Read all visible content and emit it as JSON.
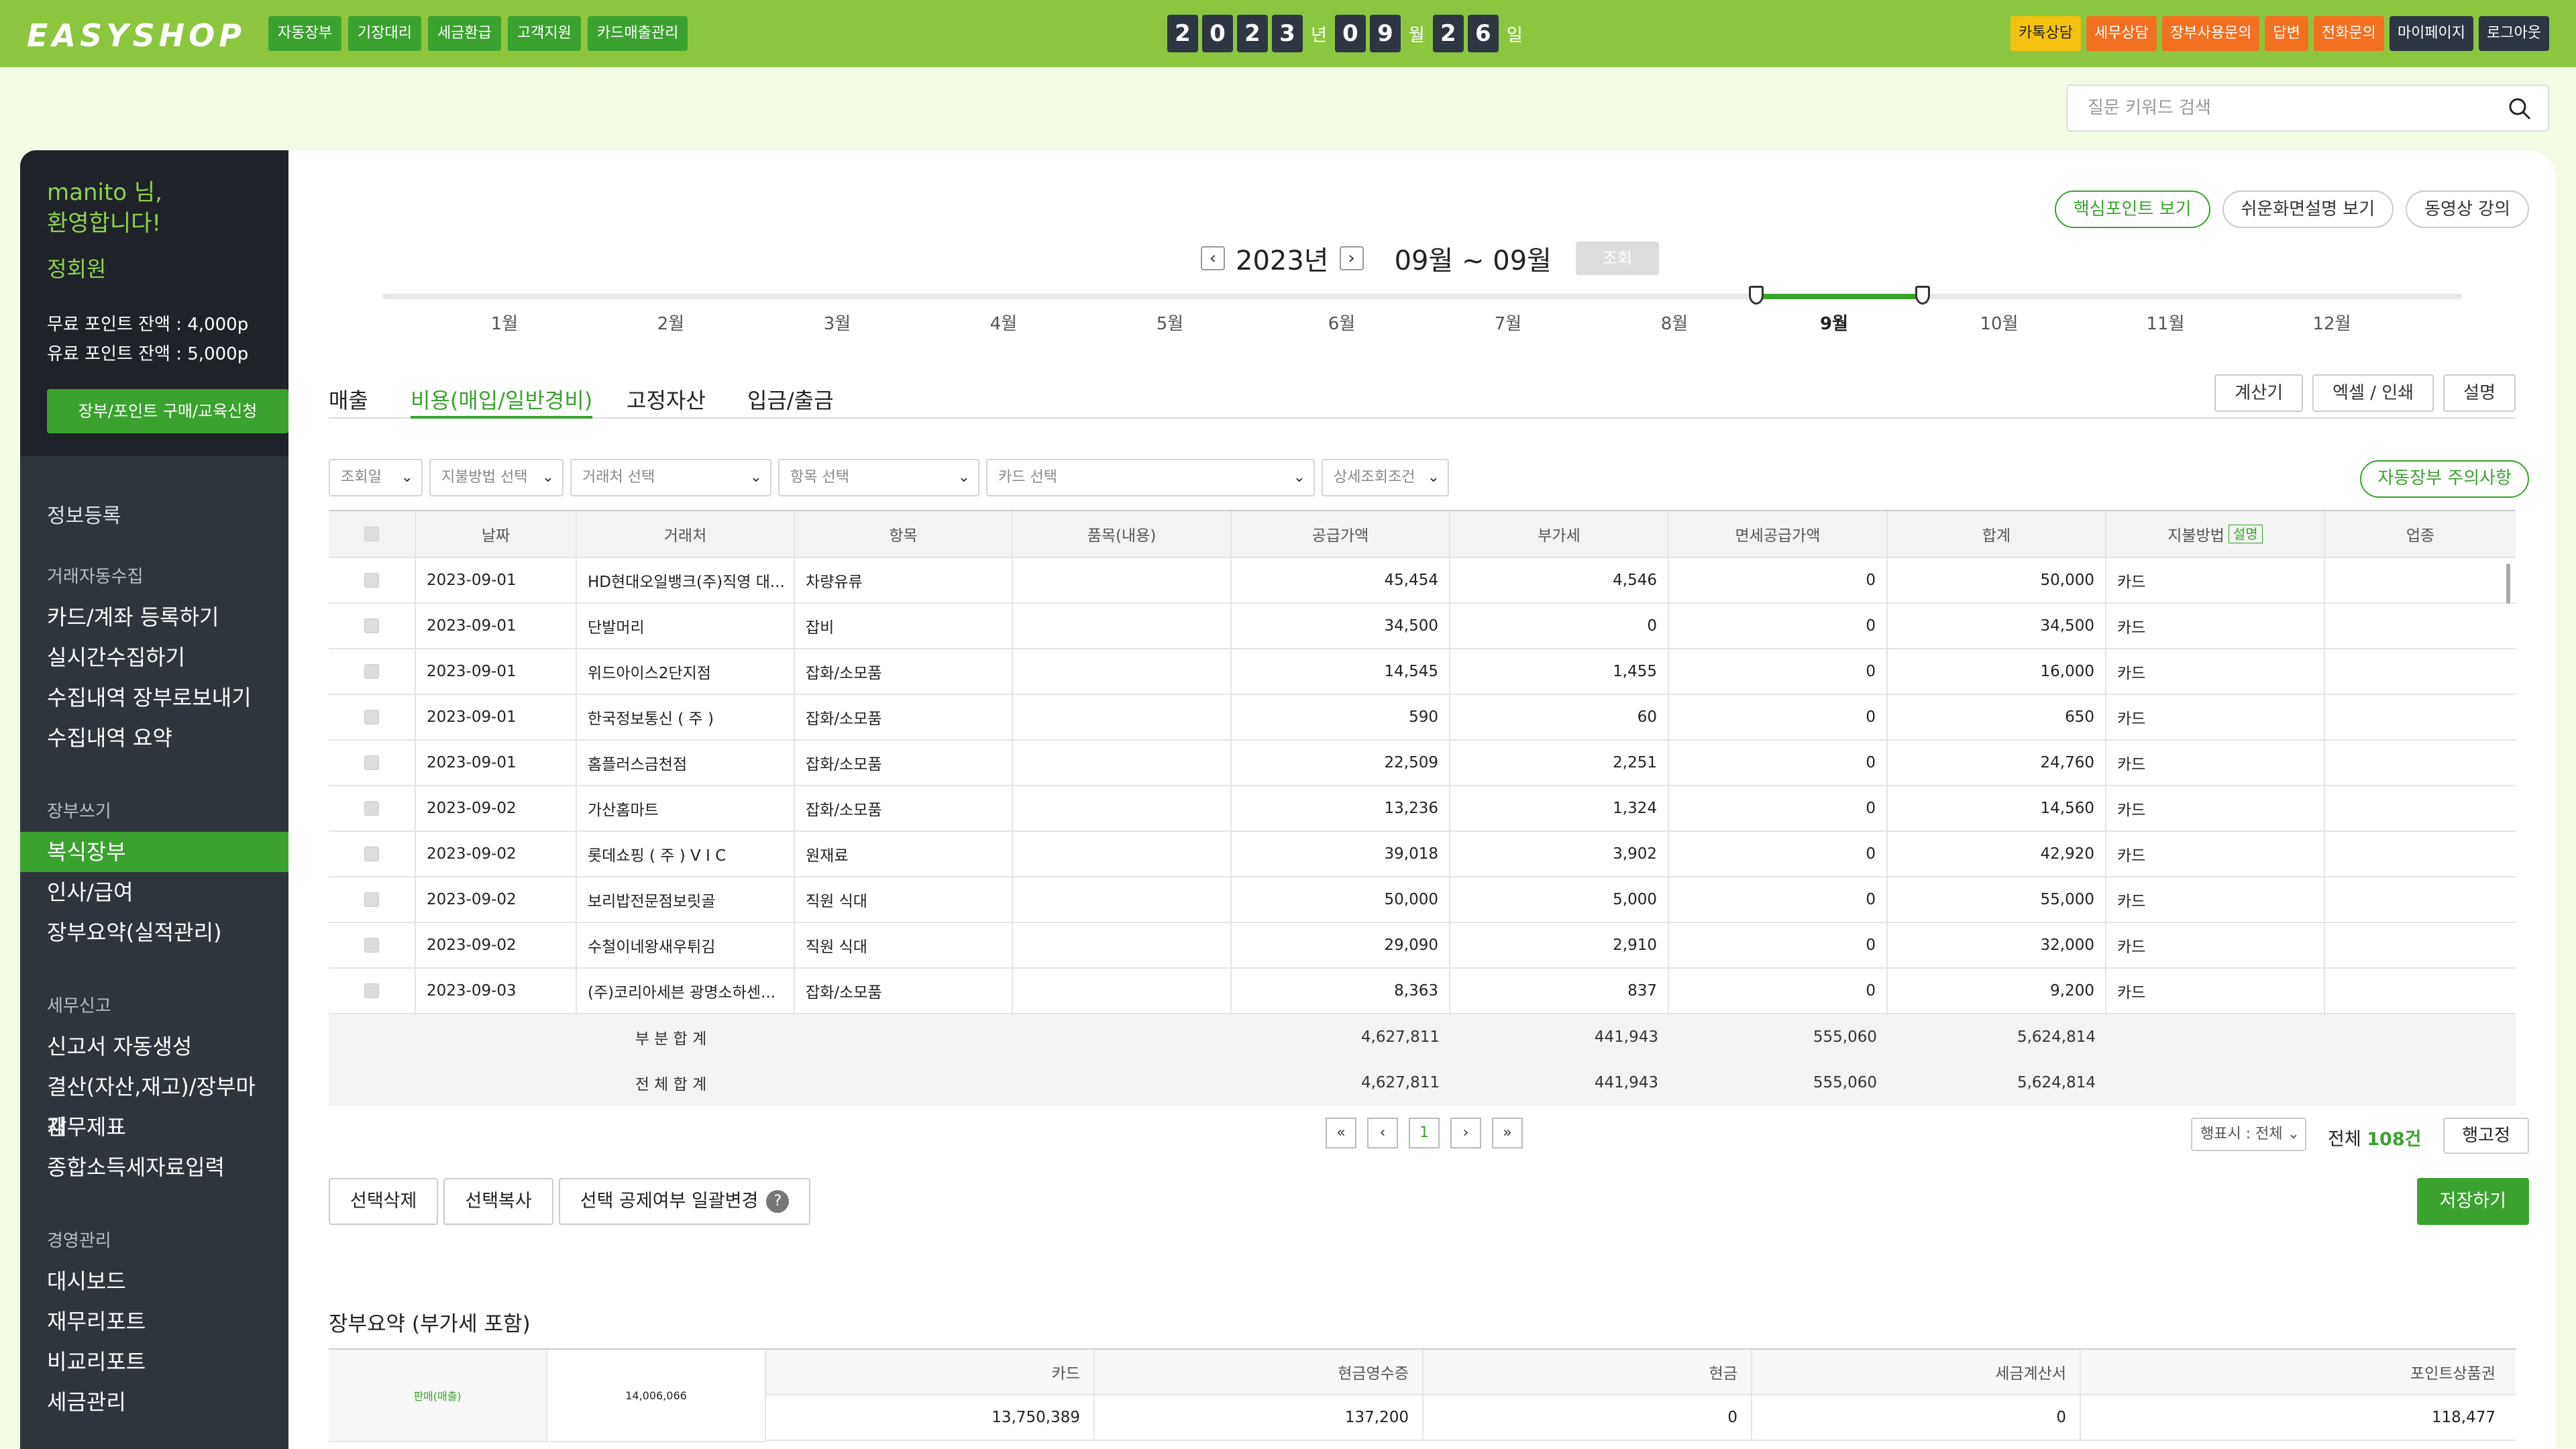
{
  "header": {
    "logo": "EASYSHOP",
    "nav": [
      "자동장부",
      "기장대리",
      "세금환급",
      "고객지원",
      "카드매출관리"
    ],
    "date": {
      "year_digits": [
        "2",
        "0",
        "2",
        "3"
      ],
      "year_unit": "년",
      "month_digits": [
        "0",
        "9"
      ],
      "month_unit": "월",
      "day_digits": [
        "2",
        "6"
      ],
      "day_unit": "일"
    },
    "right_buttons": [
      {
        "label": "카톡상담",
        "style": "yellow"
      },
      {
        "label": "세무상담",
        "style": "orange"
      },
      {
        "label": "장부사용문의",
        "style": "orange"
      },
      {
        "label": "답변",
        "style": "orange"
      },
      {
        "label": "전화문의",
        "style": "orange"
      },
      {
        "label": "마이페이지",
        "style": "dark"
      },
      {
        "label": "로그아웃",
        "style": "dark"
      }
    ]
  },
  "search": {
    "placeholder": "질문 키워드 검색"
  },
  "sidebar": {
    "welcome_line1": "manito 님,",
    "welcome_line2": "환영합니다!",
    "grade": "정회원",
    "free_points": "무료 포인트 잔액 : 4,000p",
    "paid_points": "유료 포인트 잔액 : 5,000p",
    "buy_button": "장부/포인트 구매/교육신청",
    "info_register": "정보등록",
    "sections": [
      {
        "title": "거래자동수집",
        "items": [
          "카드/계좌 등록하기",
          "실시간수집하기",
          "수집내역 장부로보내기",
          "수집내역 요약"
        ]
      },
      {
        "title": "장부쓰기",
        "items": [
          "복식장부",
          "인사/급여",
          "장부요약(실적관리)"
        ]
      },
      {
        "title": "세무신고",
        "items": [
          "신고서 자동생성",
          "결산(자산,재고)/장부마감",
          "재무제표",
          "종합소득세자료입력"
        ]
      },
      {
        "title": "경영관리",
        "items": [
          "대시보드",
          "재무리포트",
          "비교리포트",
          "세금관리"
        ]
      }
    ],
    "active_item": "복식장부"
  },
  "help_buttons": [
    "핵심포인트 보기",
    "쉬운화면설명 보기",
    "동영상 강의"
  ],
  "period": {
    "year": "2023년",
    "months": "09월 ~ 09월",
    "lookup": "조회"
  },
  "month_slider": {
    "labels": [
      "1월",
      "2월",
      "3월",
      "4월",
      "5월",
      "6월",
      "7월",
      "8월",
      "9월",
      "10월",
      "11월",
      "12월"
    ],
    "selected": "9월",
    "range_start_month": 9,
    "range_end_month": 9
  },
  "tabs": [
    "매출",
    "비용(매입/일반경비)",
    "고정자산",
    "입금/출금"
  ],
  "active_tab": "비용(매입/일반경비)",
  "tab_actions": [
    "계산기",
    "엑셀 / 인쇄",
    "설명"
  ],
  "filters": [
    "조회일",
    "지불방법 선택",
    "거래처 선택",
    "항목 선택",
    "카드 선택",
    "상세조회조건"
  ],
  "warning_button": "자동장부 주의사항",
  "table": {
    "headers": [
      "날짜",
      "거래처",
      "항목",
      "품목(내용)",
      "공급가액",
      "부가세",
      "면세공급가액",
      "합계",
      "지불방법",
      "업종"
    ],
    "pay_badge": "설명",
    "rows": [
      [
        "2023-09-01",
        "HD현대오일뱅크(주)직영 대...",
        "차량유류",
        "",
        "45,454",
        "4,546",
        "0",
        "50,000",
        "카드",
        ""
      ],
      [
        "2023-09-01",
        "단발머리",
        "잡비",
        "",
        "34,500",
        "0",
        "0",
        "34,500",
        "카드",
        ""
      ],
      [
        "2023-09-01",
        "위드아이스2단지점",
        "잡화/소모품",
        "",
        "14,545",
        "1,455",
        "0",
        "16,000",
        "카드",
        ""
      ],
      [
        "2023-09-01",
        "한국정보통신 ( 주 )",
        "잡화/소모품",
        "",
        "590",
        "60",
        "0",
        "650",
        "카드",
        ""
      ],
      [
        "2023-09-01",
        "홈플러스금천점",
        "잡화/소모품",
        "",
        "22,509",
        "2,251",
        "0",
        "24,760",
        "카드",
        ""
      ],
      [
        "2023-09-02",
        "가산홈마트",
        "잡화/소모품",
        "",
        "13,236",
        "1,324",
        "0",
        "14,560",
        "카드",
        ""
      ],
      [
        "2023-09-02",
        "롯데쇼핑 ( 주 ) V I C",
        "원재료",
        "",
        "39,018",
        "3,902",
        "0",
        "42,920",
        "카드",
        ""
      ],
      [
        "2023-09-02",
        "보리밥전문점보릿골",
        "직원 식대",
        "",
        "50,000",
        "5,000",
        "0",
        "55,000",
        "카드",
        ""
      ],
      [
        "2023-09-02",
        "수철이네왕새우튀김",
        "직원 식대",
        "",
        "29,090",
        "2,910",
        "0",
        "32,000",
        "카드",
        ""
      ],
      [
        "2023-09-03",
        "(주)코리아세븐 광명소하센...",
        "잡화/소모품",
        "",
        "8,363",
        "837",
        "0",
        "9,200",
        "카드",
        ""
      ]
    ],
    "subtotal": {
      "label": "부 분 합 계",
      "supply": "4,627,811",
      "vat": "441,943",
      "exempt": "555,060",
      "total": "5,624,814"
    },
    "grandtotal": {
      "label": "전 체 합 계",
      "supply": "4,627,811",
      "vat": "441,943",
      "exempt": "555,060",
      "total": "5,624,814"
    }
  },
  "pagination": {
    "first": "«",
    "prev": "‹",
    "current": "1",
    "next": "›",
    "last": "»"
  },
  "rows_select": "행표시 : 전체",
  "total_count": {
    "prefix": "전체 ",
    "count": "108건"
  },
  "fix_rows_button": "행고정",
  "bottom_actions": [
    "선택삭제",
    "선택복사",
    "선택 공제여부 일괄변경"
  ],
  "save_button": "저장하기",
  "summary": {
    "title": "장부요약 (부가세 포함)",
    "row_label": "판매(매출)",
    "row_total": "14,006,066",
    "headers": [
      "카드",
      "현금영수증",
      "현금",
      "세금계산서",
      "포인트상품권"
    ],
    "values": [
      "13,750,389",
      "137,200",
      "0",
      "0",
      "118,477"
    ]
  },
  "colors": {
    "brand_green": "#8cc63f",
    "accent_green": "#3ba22f",
    "sidebar_dark": "#2f353d",
    "orange": "#f37021",
    "yellow": "#f5c211"
  }
}
